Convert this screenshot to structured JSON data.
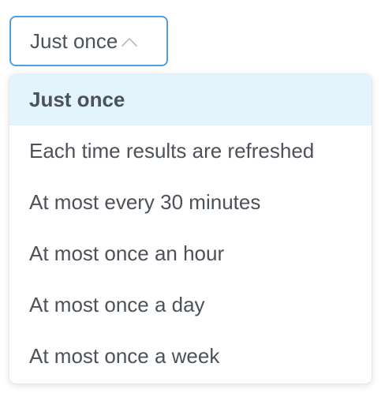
{
  "select": {
    "value": "Just once",
    "icon": "chevron-up-icon",
    "accent_color": "#509ee3"
  },
  "dropdown": {
    "selected_index": 0,
    "highlight_color": "#e3f4fd",
    "options": [
      {
        "label": "Just once"
      },
      {
        "label": "Each time results are refreshed"
      },
      {
        "label": "At most every 30 minutes"
      },
      {
        "label": "At most once an hour"
      },
      {
        "label": "At most once a day"
      },
      {
        "label": "At most once a week"
      }
    ]
  }
}
